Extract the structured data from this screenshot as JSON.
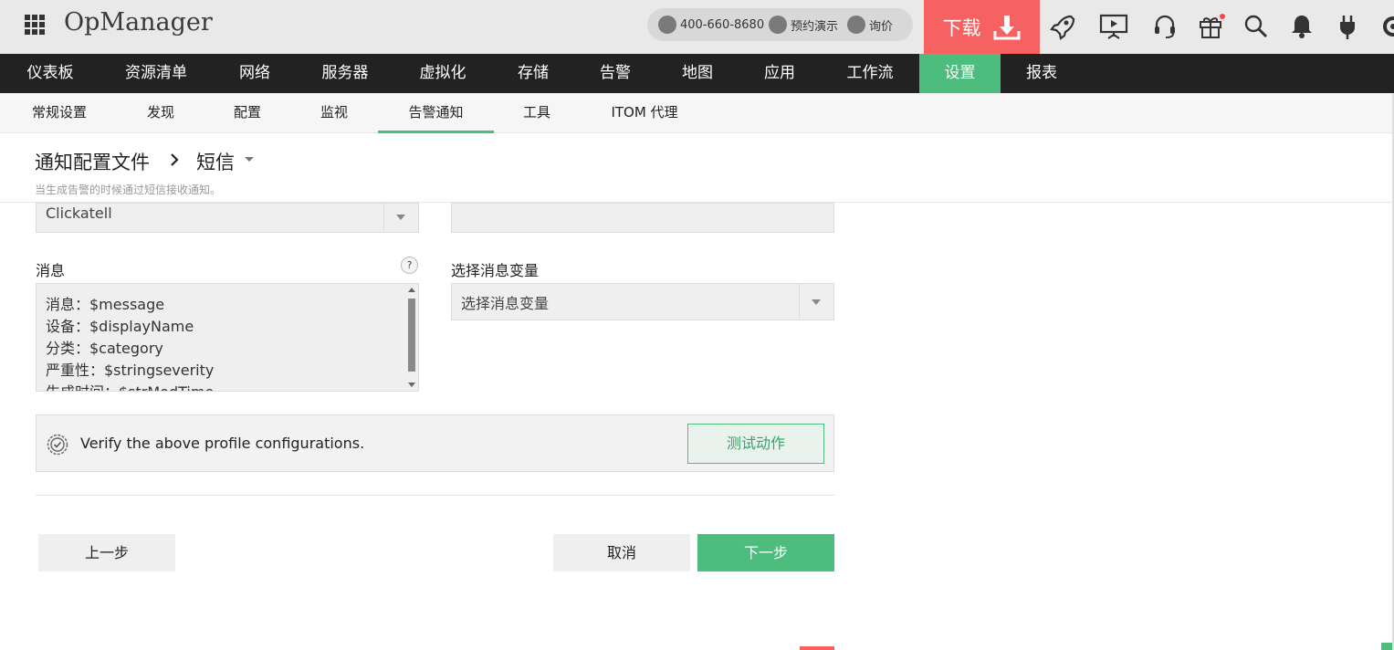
{
  "header": {
    "app_name": "OpManager",
    "phone": "400-660-8680",
    "demo_label": "预约演示",
    "price_label": "询价",
    "download_label": "下载",
    "icons": [
      "rocket-icon",
      "presentation-icon",
      "headset-icon",
      "gift-icon",
      "search-icon",
      "bell-icon",
      "plug-icon",
      "gear-icon"
    ]
  },
  "main_nav": {
    "items": [
      "仪表板",
      "资源清单",
      "网络",
      "服务器",
      "虚拟化",
      "存储",
      "告警",
      "地图",
      "应用",
      "工作流",
      "设置",
      "报表"
    ],
    "active": "设置"
  },
  "sub_nav": {
    "items": [
      "常规设置",
      "发现",
      "配置",
      "监视",
      "告警通知",
      "工具",
      "ITOM 代理"
    ],
    "active": "告警通知"
  },
  "page": {
    "breadcrumb_root": "通知配置文件",
    "breadcrumb_current": "短信",
    "description": "当生成告警的时候通过短信接收通知。"
  },
  "form": {
    "provider_value": "Clickatell",
    "message_label": "消息",
    "help_symbol": "?",
    "message_lines": [
      "消息：$message",
      "设备：$displayName",
      "分类：$category",
      "严重性：$stringseverity",
      "生成时间：$strModTime"
    ],
    "variable_label": "选择消息变量",
    "variable_placeholder": "选择消息变量"
  },
  "verify": {
    "text": "Verify the above profile configurations.",
    "test_button": "测试动作"
  },
  "buttons": {
    "prev": "上一步",
    "cancel": "取消",
    "next": "下一步"
  },
  "colors": {
    "accent_green": "#4cbd7d",
    "download_red": "#f66262",
    "nav_dark": "#222222"
  }
}
